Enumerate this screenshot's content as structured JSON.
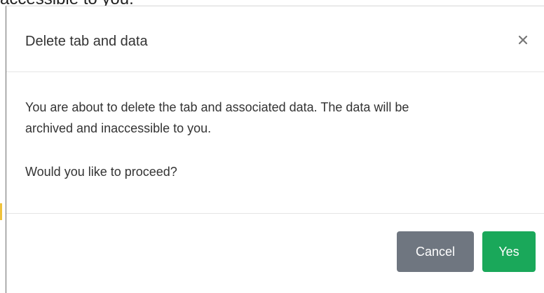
{
  "background": {
    "visible_text": "accessible to you."
  },
  "dialog": {
    "title": "Delete tab and data",
    "close_symbol": "×",
    "message_line1": "You are about to delete the tab and associated data. The data will be",
    "message_line2": "archived and inaccessible to you.",
    "question": "Would you like to proceed?",
    "cancel_label": "Cancel",
    "yes_label": "Yes",
    "icons": {
      "close": "close-icon"
    }
  },
  "colors": {
    "cancel_button": "#6f7680",
    "yes_button": "#1aa85a",
    "divider": "#e5e5e5",
    "text": "#333333",
    "close_icon": "#777777"
  }
}
